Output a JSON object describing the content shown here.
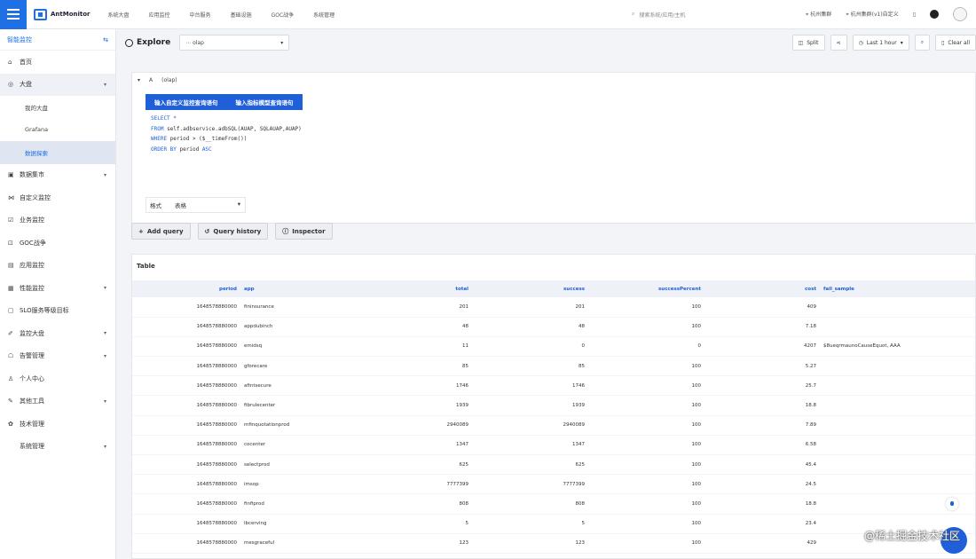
{
  "topbar": {
    "logo_text": "AntMonitor",
    "nav": [
      "系统大盘",
      "应用监控",
      "中台服务",
      "基础设施",
      "GOC战争",
      "系统管理"
    ],
    "search_placeholder": "搜索系统/应用/主机",
    "env_label": "杭州集群",
    "zone_label": "杭州集群(v1)自定义",
    "icons": {
      "menu": "hamburger-icon",
      "search": "search-icon",
      "help": "help-icon",
      "user": "avatar"
    }
  },
  "sidebar": {
    "title": "智能监控",
    "items": [
      {
        "icon": "⌂",
        "label": "首页",
        "name": "home"
      },
      {
        "icon": "◎",
        "label": "大盘",
        "name": "dashboard",
        "caret": "▾",
        "open": true,
        "children": [
          {
            "label": "我的大盘",
            "active": false
          },
          {
            "label": "Grafana",
            "active": false
          },
          {
            "label": "数据探索",
            "active": true
          }
        ]
      },
      {
        "icon": "▣",
        "label": "数据集市",
        "name": "data-market",
        "caret": "▾"
      },
      {
        "icon": "⋈",
        "label": "自定义监控",
        "name": "custom-monitor"
      },
      {
        "icon": "☑",
        "label": "业务监控",
        "name": "biz-monitor"
      },
      {
        "icon": "⊡",
        "label": "GOC战争",
        "name": "goc"
      },
      {
        "icon": "▤",
        "label": "应用监控",
        "name": "app-monitor"
      },
      {
        "icon": "▦",
        "label": "性能监控",
        "name": "perf-monitor",
        "caret": "▾"
      },
      {
        "icon": "▢",
        "label": "SLO服务等级目标",
        "name": "slo"
      },
      {
        "icon": "✐",
        "label": "监控大盘",
        "name": "monitor-board",
        "caret": "▾"
      },
      {
        "icon": "☖",
        "label": "告警管理",
        "name": "alert-manage",
        "caret": "▾"
      },
      {
        "icon": "♙",
        "label": "个人中心",
        "name": "profile"
      },
      {
        "icon": "✎",
        "label": "其他工具",
        "name": "tools",
        "caret": "▾"
      },
      {
        "icon": "✿",
        "label": "技术管理",
        "name": "tech-manage"
      },
      {
        "icon": "",
        "label": "系统管理",
        "name": "system-manage",
        "caret": "▾"
      }
    ]
  },
  "explore": {
    "title": "Explore",
    "datasource": "olap",
    "buttons": {
      "split": "Split",
      "time": "Last 1 hour",
      "clear": "Clear all"
    }
  },
  "query": {
    "row_label": "A",
    "row_sub": "(olap)",
    "tabs": [
      "输入自定义监控查询语句",
      "输入指标模型查询语句"
    ],
    "sql": [
      [
        {
          "t": "SELECT *",
          "k": true
        }
      ],
      [
        {
          "t": "FROM",
          "k": true
        },
        {
          "t": " self.adbservice.adbSQL(AUAP, SQLAUAP,AUAP)",
          "k": false
        }
      ],
      [
        {
          "t": "WHERE",
          "k": true
        },
        {
          "t": "  period   > ($__timeFrom())",
          "k": false
        }
      ],
      [
        {
          "t": "ORDER BY",
          "k": true
        },
        {
          "t": "  period  ",
          "k": false
        },
        {
          "t": "ASC",
          "k": true
        }
      ]
    ],
    "format_label": "格式",
    "format_value": "表格"
  },
  "actions": {
    "add": "Add query",
    "history": "Query history",
    "inspector": "Inspector"
  },
  "table": {
    "title": "Table",
    "columns": [
      "period",
      "app",
      "total",
      "success",
      "successPercent",
      "cost",
      "fail_sample"
    ],
    "rows": [
      [
        "1648578880000",
        "fininsurance",
        "201",
        "201",
        "100",
        "409",
        ""
      ],
      [
        "1648578880000",
        "appdubinch",
        "48",
        "48",
        "100",
        "7.18",
        ""
      ],
      [
        "1648578880000",
        "emidsq",
        "11",
        "0",
        "0",
        "4207",
        "$8ueqrmaunoCauseEquot, AAA"
      ],
      [
        "1648578880000",
        "gforecare",
        "85",
        "85",
        "100",
        "5.27",
        ""
      ],
      [
        "1648578880000",
        "afintsecure",
        "1746",
        "1746",
        "100",
        "25.7",
        ""
      ],
      [
        "1648578880000",
        "fibrulecenter",
        "1939",
        "1939",
        "100",
        "18.8",
        ""
      ],
      [
        "1648578880000",
        "mfinquotationprod",
        "2940089",
        "2940089",
        "100",
        "7.89",
        ""
      ],
      [
        "1648578880000",
        "cocenter",
        "1347",
        "1347",
        "100",
        "6.58",
        ""
      ],
      [
        "1648578880000",
        "selectprod",
        "625",
        "625",
        "100",
        "45.4",
        ""
      ],
      [
        "1648578880000",
        "imsop",
        "7777399",
        "7777399",
        "100",
        "24.5",
        ""
      ],
      [
        "1648578880000",
        "finfiprod",
        "808",
        "808",
        "100",
        "18.8",
        ""
      ],
      [
        "1648578880000",
        "ibcerving",
        "5",
        "5",
        "100",
        "23.4",
        ""
      ],
      [
        "1648578880000",
        "mesgraceful",
        "123",
        "123",
        "100",
        "429",
        ""
      ]
    ]
  },
  "watermark": "@稀土掘金技术社区",
  "colors": {
    "accent": "#1f5fd8",
    "header_bg": "#eef2f8"
  }
}
